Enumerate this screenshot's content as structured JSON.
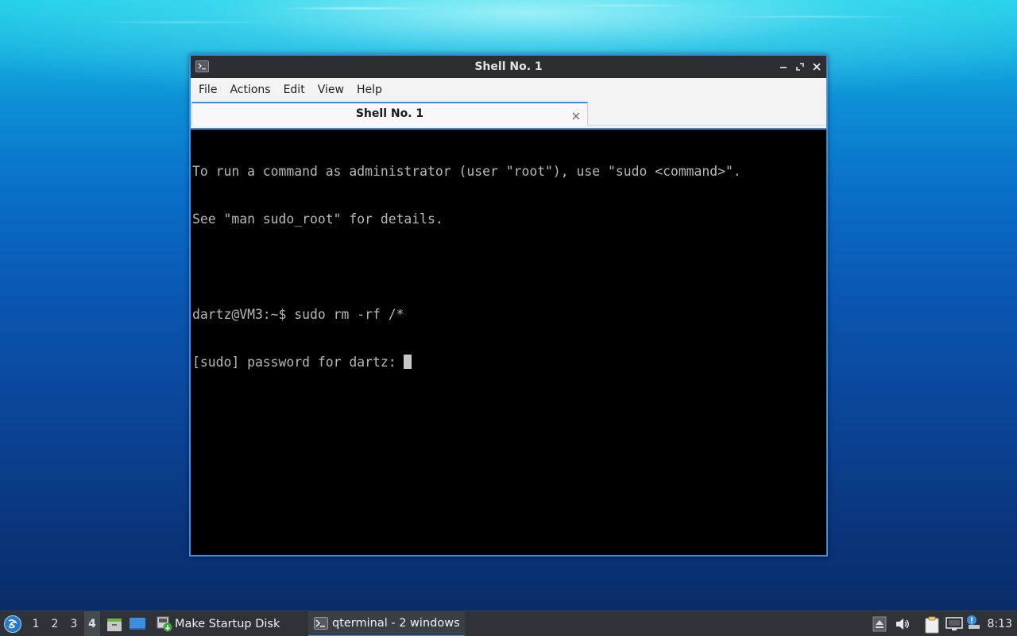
{
  "window": {
    "title": "Shell No. 1",
    "menu": [
      "File",
      "Actions",
      "Edit",
      "View",
      "Help"
    ],
    "tab_label": "Shell No. 1",
    "terminal_lines": [
      "To run a command as administrator (user \"root\"), use \"sudo <command>\".",
      "See \"man sudo_root\" for details.",
      "",
      "dartz@VM3:~$ sudo rm -rf /*",
      "[sudo] password for dartz: "
    ]
  },
  "taskbar": {
    "workspaces": [
      "1",
      "2",
      "3",
      "4"
    ],
    "active_workspace": "4",
    "tasks": [
      {
        "label": "Make Startup Disk",
        "icon": "startup-disk-icon",
        "active": false
      },
      {
        "label": "qterminal - 2 windows",
        "icon": "terminal-icon",
        "active": true
      }
    ],
    "clock": "8:13"
  },
  "colors": {
    "accent": "#3d8ee0",
    "terminal_bg": "#000000",
    "terminal_fg": "#b8b8b8",
    "titlebar_bg": "#2b2d31",
    "taskbar_bg": "#2f3338"
  }
}
